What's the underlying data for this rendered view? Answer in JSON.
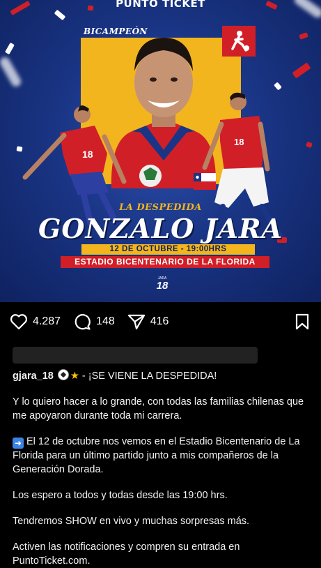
{
  "post_image": {
    "brand": "PUNTO TICKET",
    "badge_top": "BICAMPEÓN",
    "title_small": "LA DESPEDIDA",
    "title_big": "GONZALO JARA",
    "date_line": "12 DE OCTUBRE - 19:00HRS",
    "venue_line": "ESTADIO BICENTENARIO DE LA FLORIDA",
    "logo_small": "JARA",
    "logo_number": "18",
    "jersey_number": "18",
    "colors": {
      "blue": "#1a3585",
      "yellow": "#f3b51e",
      "red": "#d11f28"
    }
  },
  "actions": {
    "likes": "4.287",
    "comments": "148",
    "shares": "416"
  },
  "caption": {
    "username": "gjara_18",
    "headline": "- ¡SE VIENE LA DESPEDIDA!",
    "p1": "Y lo quiero hacer a lo grande, con todas las familias chilenas que me apoyaron durante toda mi carrera.",
    "p2": "El 12 de octubre nos vemos en el Estadio Bicentenario de La Florida para un último partido junto a mis compañeros de la Generación Dorada.",
    "p3": "Los espero a todos y todas desde las 19:00 hrs.",
    "p4": "Tendremos SHOW en vivo y muchas sorpresas más.",
    "p5": "Activen las notificaciones y compren su entrada en PuntoTicket.com."
  }
}
